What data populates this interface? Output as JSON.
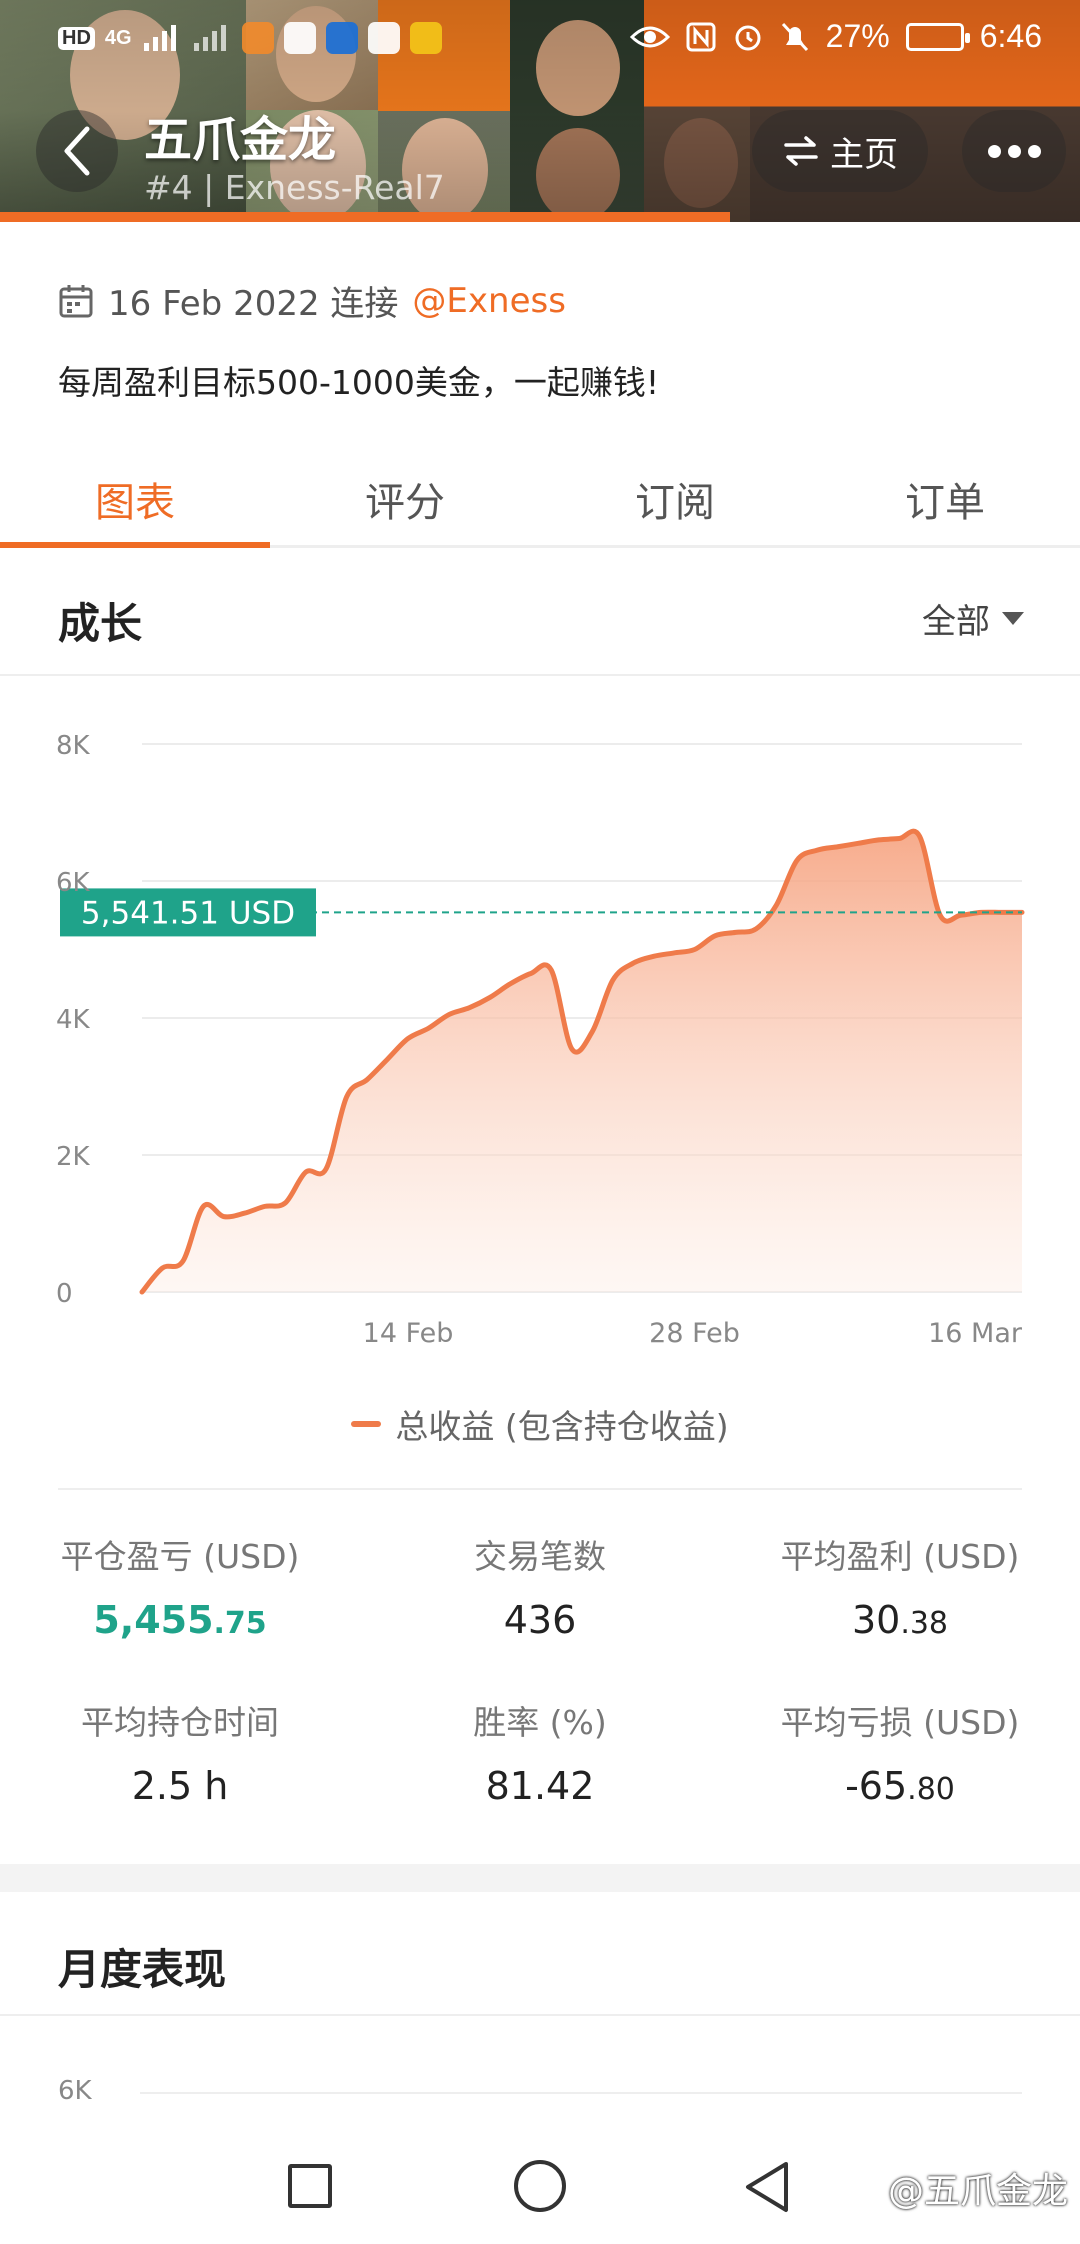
{
  "status_bar": {
    "network_badge": "HD",
    "net_1": "4G",
    "battery": "27%",
    "time": "6:46"
  },
  "header": {
    "title": "五爪金龙",
    "subtitle": "#4 | Exness-Real7",
    "home_label": "主页",
    "icons": {
      "back": "chevron-left-icon",
      "switch": "swap-arrows-icon",
      "more": "more-dots-icon"
    }
  },
  "profile": {
    "connected_date": "16 Feb 2022 连接",
    "broker": "@Exness",
    "description": "每周盈利目标500-1000美金，一起赚钱!"
  },
  "tabs": [
    {
      "label": "图表",
      "active": true
    },
    {
      "label": "评分",
      "active": false
    },
    {
      "label": "订阅",
      "active": false
    },
    {
      "label": "订单",
      "active": false
    }
  ],
  "growth": {
    "title": "成长",
    "range": "全部",
    "legend": "总收益 (包含持仓收益)",
    "current_label": "5,541.51 USD"
  },
  "chart_data": {
    "type": "area",
    "y_tick_labels": [
      "0",
      "2K",
      "4K",
      "6K",
      "8K"
    ],
    "ylim": [
      0,
      8000
    ],
    "x_tick_labels": [
      "14 Feb",
      "28 Feb",
      "16 Mar"
    ],
    "current_value": 5541.51,
    "grid": true,
    "series": [
      {
        "name": "总收益 (包含持仓收益)",
        "x": [
          "2022-02-01",
          "2022-02-02",
          "2022-02-03",
          "2022-02-04",
          "2022-02-05",
          "2022-02-06",
          "2022-02-07",
          "2022-02-08",
          "2022-02-09",
          "2022-02-10",
          "2022-02-11",
          "2022-02-12",
          "2022-02-13",
          "2022-02-14",
          "2022-02-15",
          "2022-02-16",
          "2022-02-17",
          "2022-02-18",
          "2022-02-19",
          "2022-02-20",
          "2022-02-21",
          "2022-02-22",
          "2022-02-23",
          "2022-02-24",
          "2022-02-25",
          "2022-02-26",
          "2022-02-27",
          "2022-02-28",
          "2022-03-01",
          "2022-03-02",
          "2022-03-03",
          "2022-03-04",
          "2022-03-05",
          "2022-03-06",
          "2022-03-07",
          "2022-03-08",
          "2022-03-09",
          "2022-03-10",
          "2022-03-11",
          "2022-03-12",
          "2022-03-13",
          "2022-03-14",
          "2022-03-15",
          "2022-03-16"
        ],
        "values": [
          0,
          350,
          450,
          1250,
          1100,
          1150,
          1250,
          1300,
          1750,
          1800,
          2850,
          3100,
          3400,
          3700,
          3850,
          4050,
          4150,
          4300,
          4500,
          4650,
          4700,
          3550,
          3800,
          4550,
          4800,
          4900,
          4950,
          5000,
          5200,
          5250,
          5300,
          5650,
          6300,
          6450,
          6500,
          6550,
          6600,
          6620,
          6650,
          5500,
          5500,
          5541.51,
          5541.51,
          5541.51
        ]
      }
    ]
  },
  "stats": [
    {
      "label": "平仓盈亏 (USD)",
      "main": "5,455",
      "cents": ".75",
      "style": "green"
    },
    {
      "label": "交易笔数",
      "main": "436",
      "cents": "",
      "style": "normal"
    },
    {
      "label": "平均盈利 (USD)",
      "main": "30",
      "cents": ".38",
      "style": "normal"
    },
    {
      "label": "平均持仓时间",
      "main": "2.5 h",
      "cents": "",
      "style": "normal"
    },
    {
      "label": "胜率 (%)",
      "main": "81.42",
      "cents": "",
      "style": "normal"
    },
    {
      "label": "平均亏损 (USD)",
      "main": "-65",
      "cents": ".80",
      "style": "normal"
    }
  ],
  "monthly": {
    "title": "月度表现",
    "axis_top": "6K"
  },
  "watermark": "@五爪金龙",
  "colors": {
    "accent": "#ef6c25",
    "line": "#ef7b4a",
    "marker": "#1fa38a"
  }
}
